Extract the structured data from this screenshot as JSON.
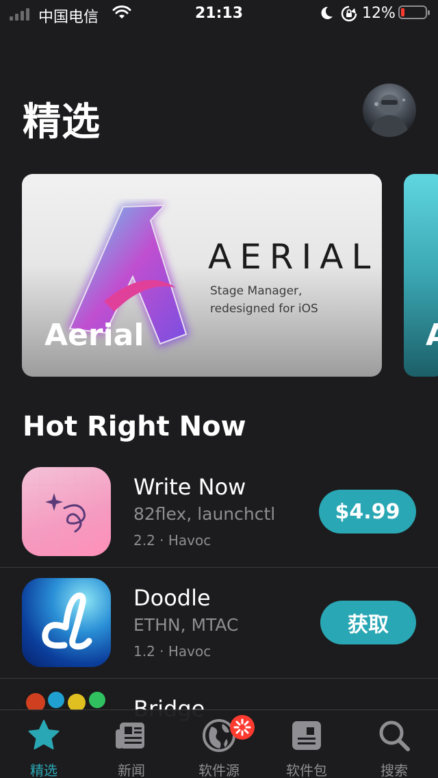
{
  "status_bar": {
    "carrier": "中国电信",
    "time": "21:13",
    "battery_percent": "12%",
    "battery_level": 0.12,
    "accent_low_battery": "#ff3b30"
  },
  "header": {
    "title": "精选",
    "avatar_icon": "profile-avatar"
  },
  "featured": {
    "banner": {
      "wordmark": "AERIAL",
      "tagline": "Stage Manager, redesigned for iOS",
      "label": "Aerial"
    },
    "next_banner_label": "A"
  },
  "hot_right_now": {
    "title": "Hot Right Now",
    "apps": [
      {
        "name": "Write Now",
        "developers": "82flex, launchctl",
        "meta": "2.2 · Havoc",
        "button": "$4.99"
      },
      {
        "name": "Doodle",
        "developers": "ETHN, MTAC",
        "meta": "1.2 · Havoc",
        "button": "获取"
      },
      {
        "name": "Bridge"
      }
    ]
  },
  "tab_bar": {
    "accent": "#2aa7b4",
    "tabs": [
      {
        "label": "精选",
        "icon": "star-icon",
        "active": true
      },
      {
        "label": "新闻",
        "icon": "newspaper-icon",
        "active": false
      },
      {
        "label": "软件源",
        "icon": "globe-icon",
        "active": false
      },
      {
        "label": "软件包",
        "icon": "package-icon",
        "active": false
      },
      {
        "label": "搜索",
        "icon": "search-icon",
        "active": false
      }
    ]
  }
}
